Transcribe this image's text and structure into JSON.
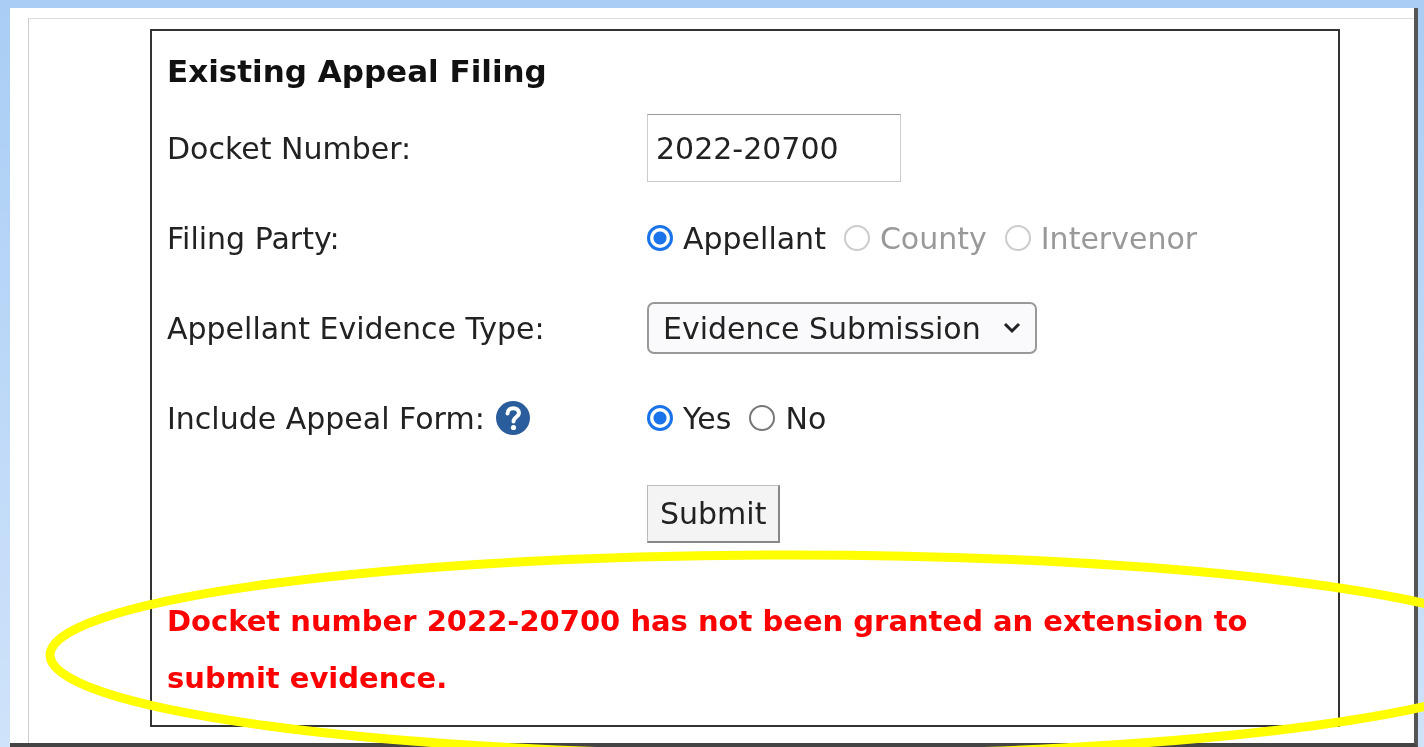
{
  "form": {
    "title": "Existing Appeal Filing",
    "fields": [
      {
        "kind": "text",
        "label": "Docket Number:",
        "value": "2022-20700"
      },
      {
        "kind": "radio",
        "label": "Filing Party:",
        "options": [
          {
            "label": "Appellant",
            "selected": true,
            "disabled": false
          },
          {
            "label": "County",
            "selected": false,
            "disabled": true
          },
          {
            "label": "Intervenor",
            "selected": false,
            "disabled": true
          }
        ]
      },
      {
        "kind": "select",
        "label": "Appellant Evidence Type:",
        "value": "Evidence Submission"
      },
      {
        "kind": "radio",
        "label": "Include Appeal Form:",
        "help": true,
        "options": [
          {
            "label": "Yes",
            "selected": true,
            "disabled": false
          },
          {
            "label": "No",
            "selected": false,
            "disabled": false
          }
        ]
      }
    ],
    "submit": "Submit",
    "error": "Docket number 2022-20700 has not been granted an extension to submit evidence."
  },
  "highlight": true
}
